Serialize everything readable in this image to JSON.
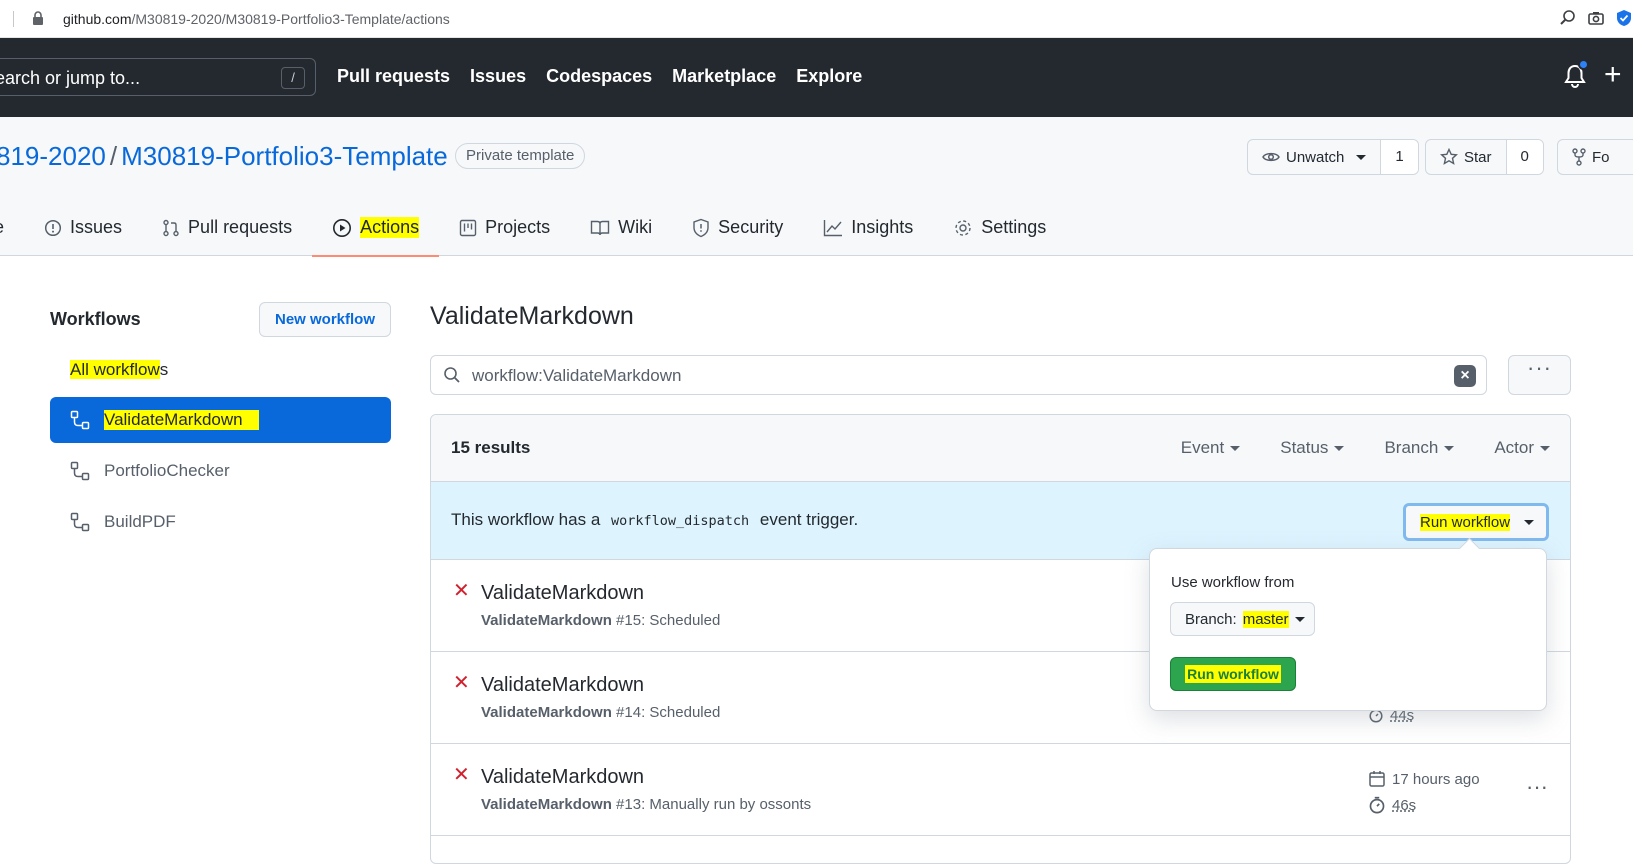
{
  "browser": {
    "url_domain": "github.com",
    "url_path": "/M30819-2020/M30819-Portfolio3-Template/actions"
  },
  "header": {
    "search_placeholder": "earch or jump to...",
    "slash_key": "/",
    "nav": [
      "Pull requests",
      "Issues",
      "Codespaces",
      "Marketplace",
      "Explore"
    ],
    "plus": "+"
  },
  "repo": {
    "owner": "819-2020",
    "separator": "/",
    "name": "M30819-Portfolio3-Template",
    "badge": "Private template",
    "unwatch_label": "Unwatch",
    "unwatch_count": "1",
    "star_label": "Star",
    "star_count": "0",
    "fork_label": "Fo"
  },
  "tabs": {
    "code_partial": "e",
    "issues": "Issues",
    "pull_requests": "Pull requests",
    "actions": "Actions",
    "projects": "Projects",
    "wiki": "Wiki",
    "security": "Security",
    "insights": "Insights",
    "settings": "Settings"
  },
  "sidebar": {
    "title": "Workflows",
    "new_workflow": "New workflow",
    "all_workflows_hl": "All workflow",
    "all_workflows_rest": "s",
    "items": [
      "ValidateMarkdown",
      "PortfolioChecker",
      "BuildPDF"
    ]
  },
  "main": {
    "title": "ValidateMarkdown",
    "filter_value": "workflow:ValidateMarkdown",
    "kebab": "···",
    "results_count": "15 results",
    "filters": [
      "Event",
      "Status",
      "Branch",
      "Actor"
    ],
    "dispatch_prefix": "This workflow has a",
    "dispatch_code": "workflow_dispatch",
    "dispatch_suffix": "event trigger.",
    "run_workflow_label": "Run workflow"
  },
  "runs": [
    {
      "title": "ValidateMarkdown",
      "workflow": "ValidateMarkdown",
      "detail": "#15: Scheduled",
      "when": "",
      "duration": ""
    },
    {
      "title": "ValidateMarkdown",
      "workflow": "ValidateMarkdown",
      "detail": "#14: Scheduled",
      "when": "",
      "duration": "44s"
    },
    {
      "title": "ValidateMarkdown",
      "workflow": "ValidateMarkdown",
      "detail": "#13: Manually run by ossonts",
      "when": "17 hours ago",
      "duration": "46s"
    }
  ],
  "popover": {
    "label": "Use workflow from",
    "branch_prefix": "Branch: ",
    "branch_name": "master",
    "run_button": "Run workflow"
  },
  "colors": {
    "header_bg": "#24292f",
    "link_blue": "#0969da",
    "active_tab_underline": "#fd8c73",
    "highlight_yellow": "#ffff00",
    "fail_red": "#cf222e",
    "run_green": "#2da44e",
    "dispatch_bg": "#ddf4ff"
  }
}
